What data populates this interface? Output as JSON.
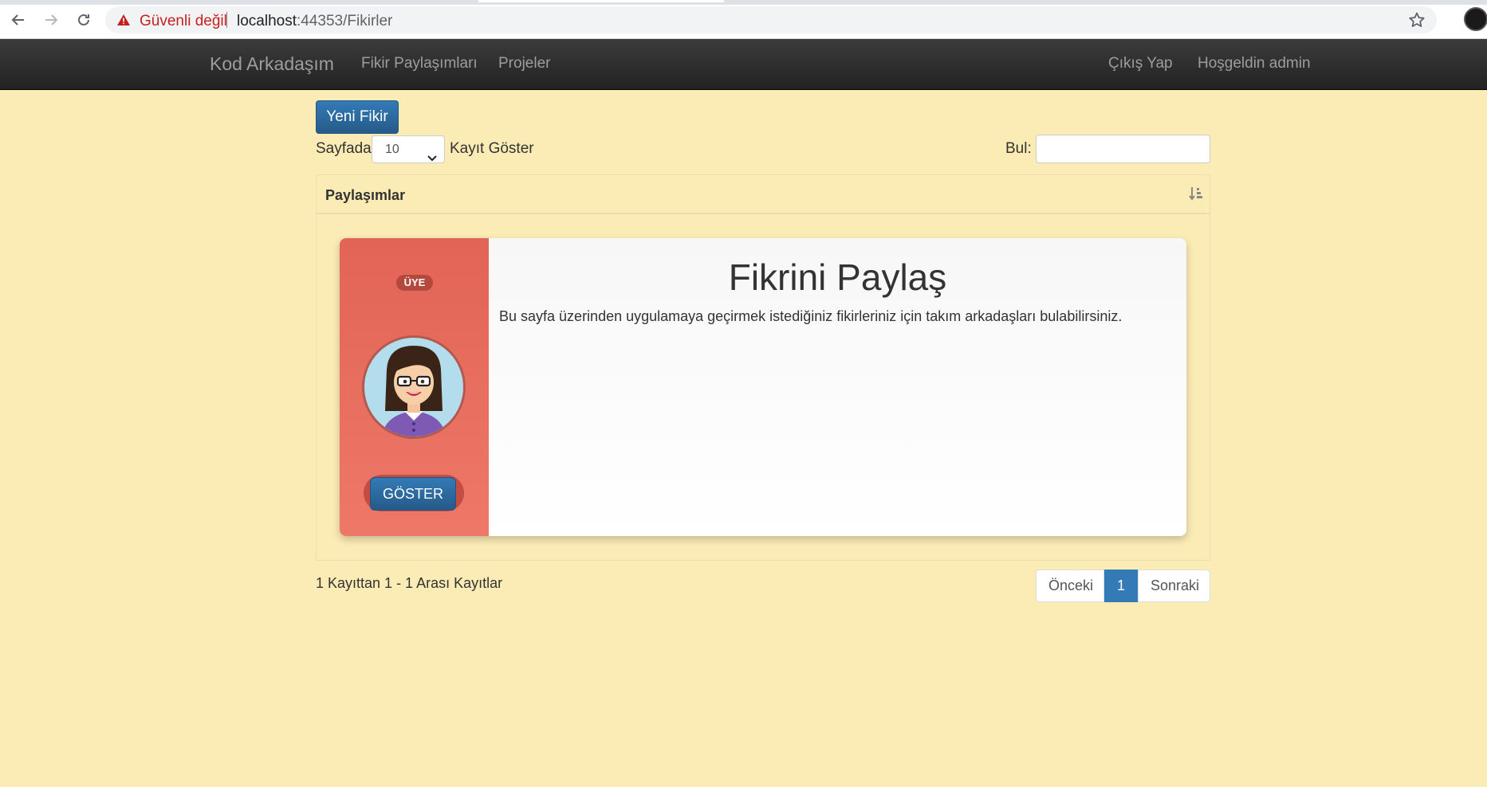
{
  "browser": {
    "security_label": "Güvenli değil",
    "url_host": "localhost",
    "url_path": ":44353/Fikirler"
  },
  "navbar": {
    "brand": "Kod Arkadaşım",
    "links": [
      "Fikir Paylaşımları",
      "Projeler"
    ],
    "logout": "Çıkış Yap",
    "welcome": "Hoşgeldin admin"
  },
  "toolbar": {
    "new_idea": "Yeni Fikir",
    "page_length_prefix": "Sayfada",
    "page_length_value": "10",
    "page_length_suffix": "Kayıt Göster",
    "search_label": "Bul:",
    "search_value": ""
  },
  "panel": {
    "title": "Paylaşımlar"
  },
  "card": {
    "badge": "ÜYE",
    "show_button": "GÖSTER",
    "title": "Fikrini Paylaş",
    "text": "Bu sayfa üzerinden uygulamaya geçirmek istediğiniz fikirleriniz için takım arkadaşları bulabilirsiniz."
  },
  "footer": {
    "info": "1 Kayıttan 1 - 1 Arası Kayıtlar",
    "prev": "Önceki",
    "current_page": "1",
    "next": "Sonraki"
  },
  "colors": {
    "page_bg": "#fbebb5",
    "navbar_bg": "#222222",
    "primary": "#337ab7",
    "card_side": "#e8695c",
    "warning": "#c5221f"
  }
}
